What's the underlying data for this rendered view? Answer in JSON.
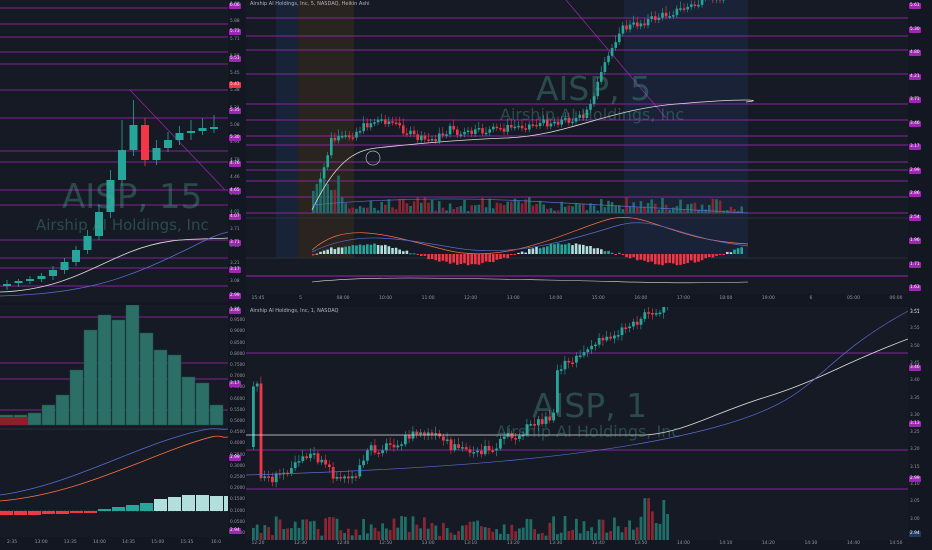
{
  "colors": {
    "up": "#26a69a",
    "down": "#f23645",
    "level": "#9c27b0",
    "bg": "#161a25",
    "vwap": "#e0e0e0",
    "ma": "#5b6bd1"
  },
  "panes": {
    "tf15": {
      "watermark": {
        "symbol": "AISP, 15",
        "name": "Airship AI Holdings, Inc"
      },
      "price_labels": [
        "5.88",
        "5.88",
        "5.71",
        "5.58",
        "5.45",
        "5.38",
        "5.21",
        "5.08",
        "4.93",
        "4.79",
        "4.46",
        "4.31",
        "4.02",
        "3.71",
        "3.40",
        "3.21",
        "3.08",
        "2.97"
      ],
      "tags": [
        {
          "text": "6.06",
          "color": "#9c27b0"
        },
        {
          "text": "5.73",
          "color": "#9c27b0"
        },
        {
          "text": "5.51",
          "color": "#9c27b0"
        },
        {
          "text": "5.41",
          "color": "#f23645"
        },
        {
          "text": "5.35",
          "color": "#9c27b0"
        },
        {
          "text": "5.30",
          "color": "#9c27b0"
        },
        {
          "text": "4.76",
          "color": "#9c27b0"
        },
        {
          "text": "4.65",
          "color": "#9c27b0"
        },
        {
          "text": "4.07",
          "color": "#9c27b0"
        },
        {
          "text": "3.71",
          "color": "#9c27b0"
        },
        {
          "text": "3.17",
          "color": "#9c27b0"
        },
        {
          "text": "2.99",
          "color": "#9c27b0"
        }
      ],
      "high_label": "High",
      "low_label": "Low",
      "high_value": "5.97",
      "low_value": "2.97"
    },
    "tf5": {
      "header": "Airship AI Holdings, Inc, 5, NASDAQ, Heikin Ashi",
      "watermark": {
        "symbol": "AISP, 5",
        "name": "Airship AI Holdings, Inc"
      },
      "tags": [
        {
          "text": "5.61",
          "color": "#9c27b0"
        },
        {
          "text": "5.30",
          "color": "#9c27b0"
        },
        {
          "text": "4.80",
          "color": "#9c27b0"
        },
        {
          "text": "4.21",
          "color": "#9c27b0"
        },
        {
          "text": "3.71",
          "color": "#9c27b0"
        },
        {
          "text": "3.46",
          "color": "#9c27b0"
        },
        {
          "text": "3.17",
          "color": "#9c27b0"
        },
        {
          "text": "2.99",
          "color": "#9c27b0"
        },
        {
          "text": "2.86",
          "color": "#9c27b0"
        },
        {
          "text": "2.54",
          "color": "#9c27b0"
        },
        {
          "text": "1.96",
          "color": "#9c27b0"
        },
        {
          "text": "1.71",
          "color": "#9c27b0"
        },
        {
          "text": "1.63",
          "color": "#9c27b0"
        }
      ],
      "time_labels": [
        "15:45",
        "5",
        "08:00",
        "10:00",
        "11:00",
        "12:00",
        "13:00",
        "14:00",
        "15:00",
        "16:00",
        "17:00",
        "18:00",
        "19:00",
        "6",
        "05:00",
        "06:00"
      ],
      "macd_value": "0.4900"
    },
    "tf1": {
      "header": "Airship AI Holdings, Inc, 1, NASDAQ",
      "watermark": {
        "symbol": "AISP, 1",
        "name": "Airship AI Holdings, Inc"
      },
      "price_labels": [
        "3.60",
        "3.55",
        "3.50",
        "3.45",
        "3.40",
        "3.35",
        "3.30",
        "3.25",
        "3.20",
        "3.15",
        "3.10",
        "3.05",
        "3.00",
        "2.97"
      ],
      "tags": [
        {
          "text": "3.51",
          "color": "#131722"
        },
        {
          "text": "3.46",
          "color": "#9c27b0"
        },
        {
          "text": "3.13",
          "color": "#9c27b0"
        },
        {
          "text": "2.99",
          "color": "#9c27b0"
        },
        {
          "text": "2.94",
          "color": "#1e3a5f"
        }
      ],
      "time_labels": [
        "12:20",
        "12:30",
        "12:40",
        "12:50",
        "13:00",
        "13:10",
        "13:20",
        "13:30",
        "13:40",
        "13:50",
        "14:00",
        "14:10",
        "14:20",
        "14:30",
        "14:40",
        "14:50"
      ],
      "low_label": "Low"
    },
    "vp": {
      "tags": [
        {
          "text": "3.46",
          "color": "#9c27b0"
        },
        {
          "text": "3.17",
          "color": "#9c27b0"
        },
        {
          "text": "2.99",
          "color": "#9c27b0"
        },
        {
          "text": "2.94",
          "color": "#9c27b0"
        }
      ],
      "price_labels": [
        "1.00",
        "0.9500",
        "0.9000",
        "0.8500",
        "0.8000",
        "0.7500",
        "0.7000",
        "0.6500",
        "0.6000",
        "0.5500",
        "0.5000",
        "0.4500",
        "0.4000",
        "0.3500",
        "0.3000",
        "0.2500",
        "0.2000",
        "0.1500",
        "0.1000",
        "0.0500",
        "0.0000"
      ],
      "time_labels": [
        "2:35",
        "13:00",
        "13:35",
        "14:00",
        "14:35",
        "15:00",
        "15:35",
        "16:0"
      ]
    }
  }
}
